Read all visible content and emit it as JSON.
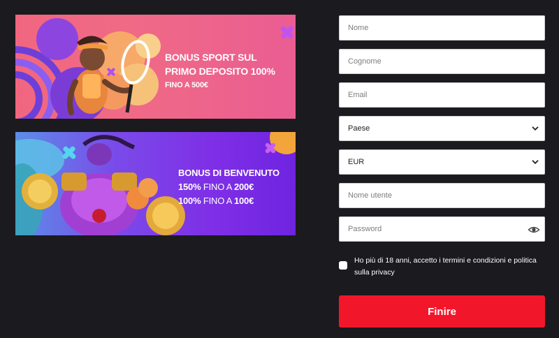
{
  "banners": {
    "sport": {
      "line1": "BONUS SPORT SUL",
      "line2": "PRIMO DEPOSITO 100%",
      "line3": "FINO A 500€"
    },
    "welcome": {
      "title": "BONUS DI BENVENUTO",
      "row2_bold": "150%",
      "row2_normal": " FINO A ",
      "row2_amount": "200€",
      "row3_bold": "100%",
      "row3_normal": " FINO A ",
      "row3_amount": "100€"
    }
  },
  "form": {
    "name_placeholder": "Nome",
    "surname_placeholder": "Cognome",
    "email_placeholder": "Email",
    "country_value": "Paese",
    "currency_value": "EUR",
    "username_placeholder": "Nome utente",
    "password_placeholder": "Password",
    "consent_text": "Ho più di 18 anni, accetto i termini e condizioni e politica sulla privacy",
    "submit_label": "Finire"
  },
  "colors": {
    "background": "#1b1a1f",
    "submit": "#f2162b",
    "sport_banner": "#f0688a",
    "welcome_banner": "#7a34e6"
  }
}
